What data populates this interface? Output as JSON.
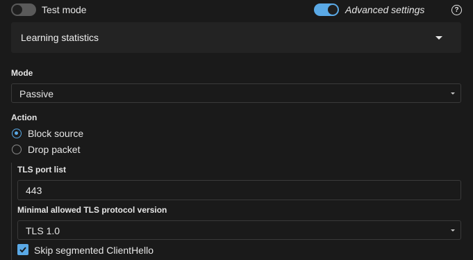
{
  "header": {
    "test_mode_label": "Test mode",
    "test_mode_enabled": false,
    "advanced_settings_label": "Advanced settings",
    "advanced_settings_enabled": true,
    "help_glyph": "?"
  },
  "learning_panel": {
    "title": "Learning statistics"
  },
  "mode": {
    "label": "Mode",
    "value": "Passive"
  },
  "action": {
    "label": "Action",
    "options": [
      {
        "label": "Block source",
        "selected": true
      },
      {
        "label": "Drop packet",
        "selected": false
      }
    ]
  },
  "tls": {
    "port_list_label": "TLS port list",
    "port_list_value": "443",
    "min_version_label": "Minimal allowed TLS protocol version",
    "min_version_value": "TLS 1.0",
    "skip_segmented_label": "Skip segmented ClientHello",
    "skip_segmented_checked": true
  },
  "colors": {
    "accent": "#5aa9e6",
    "background": "#1a1a1a",
    "panel": "#232323"
  },
  "icons": {
    "help": "help-circle-icon",
    "expand": "chevron-down-icon",
    "select_arrow": "select-arrow-icon",
    "check": "checkmark-icon"
  }
}
